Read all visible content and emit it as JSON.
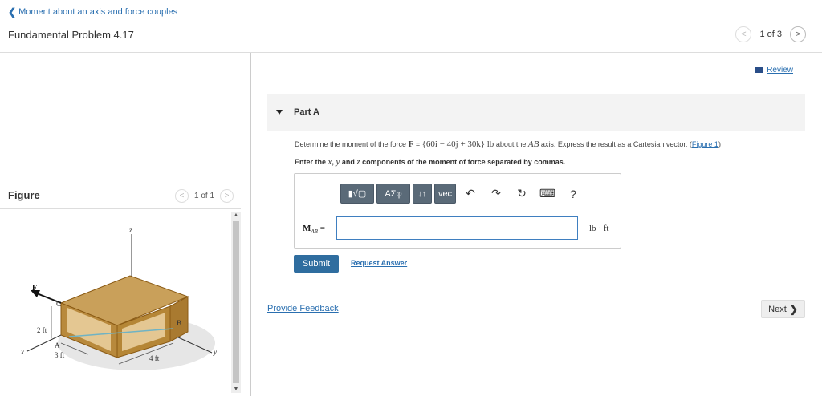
{
  "header": {
    "back_link": "Moment about an axis and force couples",
    "problem_title": "Fundamental Problem 4.17",
    "pager_text": "1 of 3"
  },
  "review_link": "Review",
  "figure": {
    "label": "Figure",
    "pager_text": "1 of 1",
    "labels": {
      "z": "z",
      "x": "x",
      "y": "y",
      "F": "F",
      "A": "A",
      "B": "B",
      "C": "C",
      "dim_2ft": "2 ft",
      "dim_3ft": "3 ft",
      "dim_4ft": "4 ft"
    }
  },
  "part": {
    "label": "Part A",
    "prompt_start": "Determine the moment of the force",
    "force_symbol": "F",
    "equals": "=",
    "force_value": "{60i − 40j + 30k}",
    "force_units": "lb",
    "prompt_mid": "about the",
    "axis_name": "AB",
    "prompt_end": "axis. Express the result as a Cartesian vector. (",
    "figure_link": "Figure 1",
    "prompt_close": ")",
    "instruction_start": "Enter the",
    "instruction_x": "x",
    "instruction_y": "y",
    "instruction_z": "z",
    "instruction_and": "and",
    "instruction_end": "components of the moment of force separated by commas."
  },
  "answer": {
    "toolbar": {
      "templates": "▮√▢",
      "greek": "ΑΣφ",
      "arrows": "↓↑",
      "vec": "vec",
      "help": "?"
    },
    "variable_main": "M",
    "variable_sub": "AB",
    "equals": "=",
    "input_value": "",
    "unit": "lb · ft"
  },
  "buttons": {
    "submit": "Submit",
    "request_answer": "Request Answer",
    "provide_feedback": "Provide Feedback",
    "next": "Next"
  },
  "colors": {
    "link": "#2a6fb0",
    "submit_bg": "#2f6d9f",
    "toolbar_bg": "#5a6a78",
    "input_border": "#3f7fc0",
    "box_wood": "#c79a4f",
    "box_edge": "#9a6a1c"
  }
}
